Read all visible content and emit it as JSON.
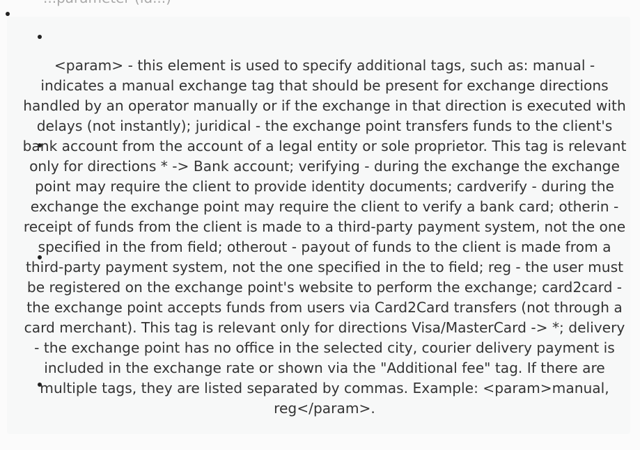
{
  "page": {
    "top_fragment": "...parameter (id...)",
    "paragraph": "<param> - this element is used to specify additional tags, such as: manual - indicates a manual exchange tag that should be present for exchange directions handled by an operator manually or if the exchange in that direction is executed with delays (not instantly); juridical - the exchange point transfers funds to the client's bank account from the account of a legal entity or sole proprietor. This tag is relevant only for directions * -> Bank account; verifying - during the exchange the exchange point may require the client to provide identity documents; cardverify - during the exchange the exchange point may require the client to verify a bank card; otherin - receipt of funds from the client is made to a third-party payment system, not the one specified in the from field; otherout - payout of funds to the client is made from a third-party payment system, not the one specified in the to field; reg - the user must be registered on the exchange point's website to perform the exchange; card2card - the exchange point accepts funds from users via Card2Card transfers (not through a card merchant). This tag is relevant only for directions Visa/MasterCard -> *; delivery - the exchange point has no office in the selected city, courier delivery payment is included in the exchange rate or shown via the \"Additional fee\" tag. If there are multiple tags, they are listed separated by commas. Example: <param>manual, reg</param>."
  }
}
